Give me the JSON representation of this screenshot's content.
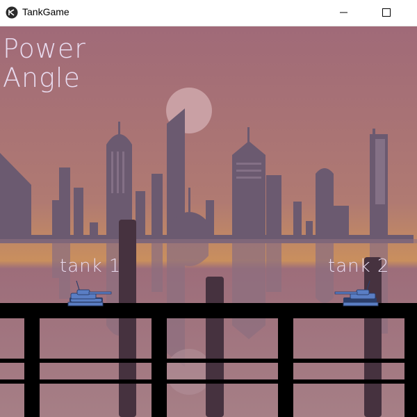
{
  "window": {
    "title": "TankGame"
  },
  "hud": {
    "power_label": "Power",
    "angle_label": "Angle"
  },
  "tanks": [
    {
      "label": "tank 1"
    },
    {
      "label": "tank 2"
    }
  ],
  "colors": {
    "sky_top": "#a06a78",
    "sky_bottom": "#c98f5e",
    "buildings": "#6b5a70",
    "reflection": "#8d6f7f",
    "moon": "#c9a0a4",
    "bridge": "#000000",
    "tank": "#5a7ec4",
    "text": "#e9dcf0"
  }
}
